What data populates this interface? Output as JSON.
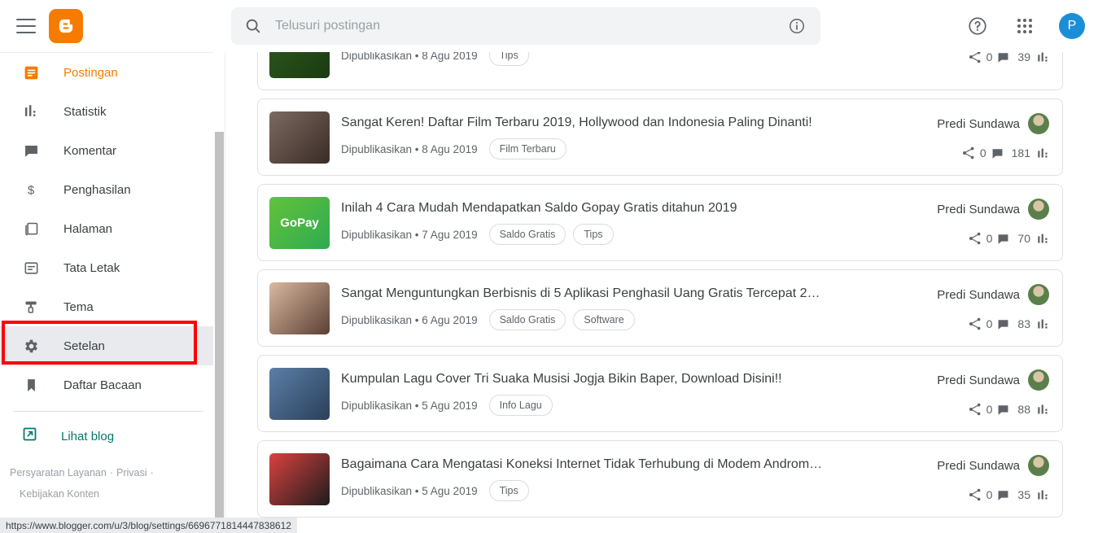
{
  "topbar": {
    "menu_icon": "hamburger-icon",
    "logo": "blogger-logo",
    "search_placeholder": "Telusuri postingan",
    "search_value": "",
    "search_icon": "search-icon",
    "info_icon": "info-icon",
    "help_icon": "help-icon",
    "apps_icon": "apps-grid-icon",
    "account_initial": "P"
  },
  "sidebar": {
    "items": [
      {
        "label": "Postingan",
        "icon": "posts-icon",
        "state": "active"
      },
      {
        "label": "Statistik",
        "icon": "stats-bars-icon",
        "state": ""
      },
      {
        "label": "Komentar",
        "icon": "comment-icon",
        "state": ""
      },
      {
        "label": "Penghasilan",
        "icon": "dollar-icon",
        "state": ""
      },
      {
        "label": "Halaman",
        "icon": "pages-icon",
        "state": ""
      },
      {
        "label": "Tata Letak",
        "icon": "layout-icon",
        "state": ""
      },
      {
        "label": "Tema",
        "icon": "theme-brush-icon",
        "state": ""
      },
      {
        "label": "Setelan",
        "icon": "gear-icon",
        "state": "selected"
      },
      {
        "label": "Daftar Bacaan",
        "icon": "bookmark-icon",
        "state": ""
      }
    ],
    "view_blog": {
      "label": "Lihat blog",
      "icon": "external-link-icon"
    },
    "legal": {
      "terms": "Persyaratan Layanan",
      "privacy": "Privasi",
      "content_policy": "Kebijakan Konten",
      "separator": "·"
    }
  },
  "posts": [
    {
      "title": "",
      "status": "Dipublikasikan",
      "date": "8 Agu 2019",
      "tags": [
        "Tips"
      ],
      "author": "",
      "shares": "0",
      "views": "39",
      "thumb_colors": [
        "#2f5a1e",
        "#1a3a10"
      ],
      "partial": true
    },
    {
      "title": "Sangat Keren! Daftar Film Terbaru 2019, Hollywood dan Indonesia Paling Dinanti!",
      "status": "Dipublikasikan",
      "date": "8 Agu 2019",
      "tags": [
        "Film Terbaru"
      ],
      "author": "Predi Sundawa",
      "shares": "0",
      "views": "181",
      "thumb_colors": [
        "#7b6a60",
        "#3a2b26"
      ],
      "partial": false
    },
    {
      "title": "Inilah 4 Cara Mudah Mendapatkan Saldo Gopay Gratis ditahun 2019",
      "status": "Dipublikasikan",
      "date": "7 Agu 2019",
      "tags": [
        "Saldo Gratis",
        "Tips"
      ],
      "author": "Predi Sundawa",
      "shares": "0",
      "views": "70",
      "thumb_colors": [
        "#63c23a",
        "#2faa52"
      ],
      "thumb_text": "GoPay",
      "partial": false
    },
    {
      "title": "Sangat Menguntungkan Berbisnis di 5 Aplikasi Penghasil Uang Gratis Tercepat 2…",
      "status": "Dipublikasikan",
      "date": "6 Agu 2019",
      "tags": [
        "Saldo Gratis",
        "Software"
      ],
      "author": "Predi Sundawa",
      "shares": "0",
      "views": "83",
      "thumb_colors": [
        "#d9b9a0",
        "#5a3f33"
      ],
      "partial": false
    },
    {
      "title": "Kumpulan Lagu Cover Tri Suaka Musisi Jogja Bikin Baper, Download Disini!!",
      "status": "Dipublikasikan",
      "date": "5 Agu 2019",
      "tags": [
        "Info Lagu"
      ],
      "author": "Predi Sundawa",
      "shares": "0",
      "views": "88",
      "thumb_colors": [
        "#5b7fa8",
        "#2b3f58"
      ],
      "partial": false
    },
    {
      "title": "Bagaimana Cara Mengatasi Koneksi Internet Tidak Terhubung di Modem Androm…",
      "status": "Dipublikasikan",
      "date": "5 Agu 2019",
      "tags": [
        "Tips"
      ],
      "author": "Predi Sundawa",
      "shares": "0",
      "views": "35",
      "thumb_colors": [
        "#d9423f",
        "#1c1c1c"
      ],
      "partial": false
    }
  ],
  "statusbar": {
    "url": "https://www.blogger.com/u/3/blog/settings/6696771814447838612"
  },
  "colors": {
    "accent_orange": "#f57c00",
    "highlight_red": "#ff0000",
    "teal_link": "#00796b",
    "avatar_blue": "#1a8fd8",
    "selected_bg": "#e8eaed"
  }
}
